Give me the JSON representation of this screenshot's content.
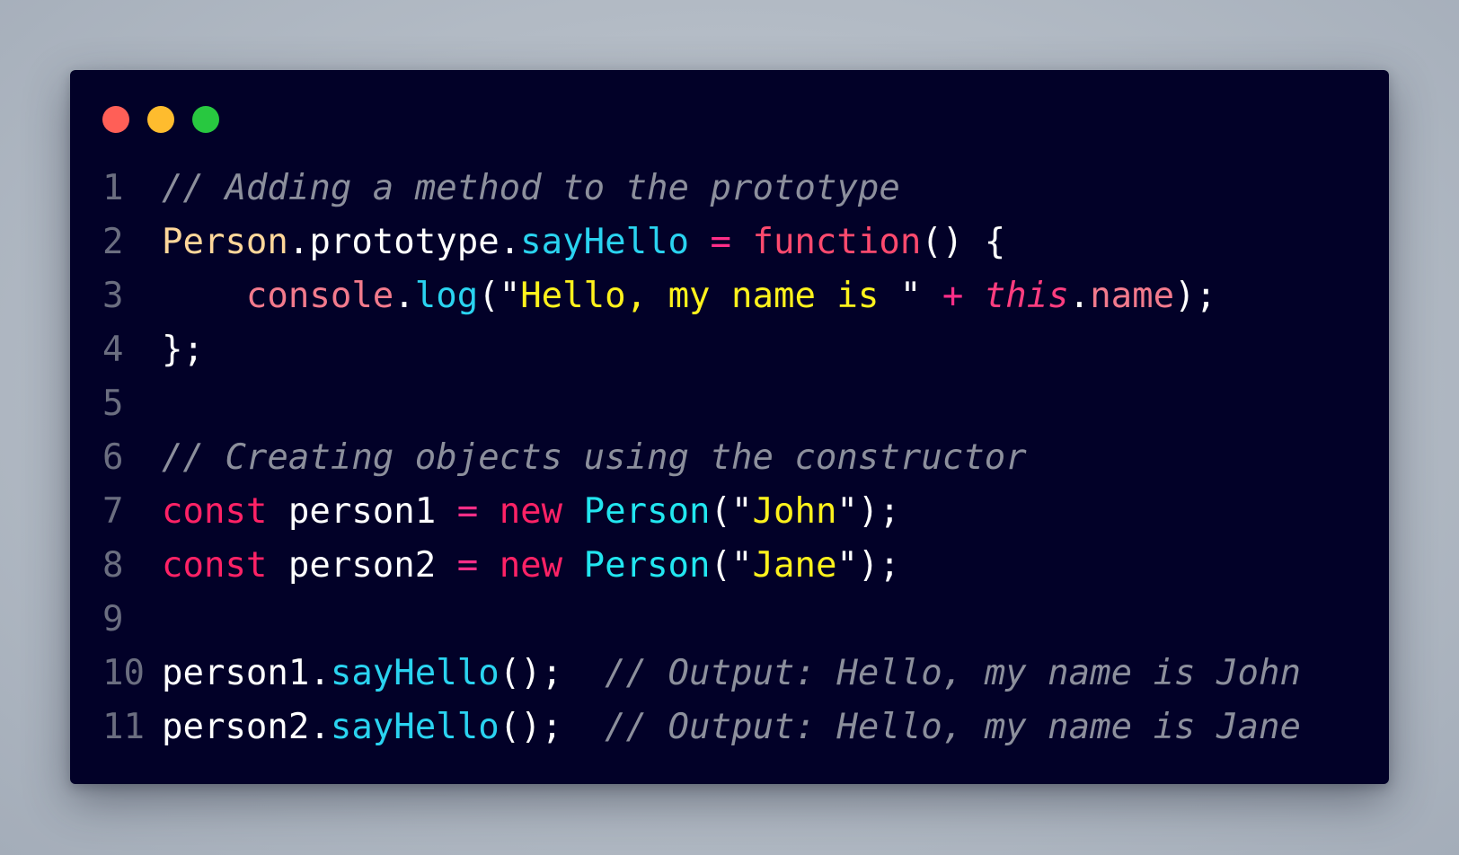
{
  "window": {
    "controls": {
      "close_color": "#ff5f57",
      "minimize_color": "#febc2e",
      "maximize_color": "#28c840"
    },
    "background_color": "#020128"
  },
  "code": {
    "lines": [
      {
        "number": "1",
        "tokens": [
          {
            "text": "// Adding a method to the prototype",
            "type": "comment"
          }
        ]
      },
      {
        "number": "2",
        "tokens": [
          {
            "text": "Person",
            "type": "cls"
          },
          {
            "text": ".prototype.",
            "type": "plain"
          },
          {
            "text": "sayHello",
            "type": "method"
          },
          {
            "text": " ",
            "type": "plain"
          },
          {
            "text": "=",
            "type": "op"
          },
          {
            "text": " ",
            "type": "plain"
          },
          {
            "text": "function",
            "type": "fn"
          },
          {
            "text": "() {",
            "type": "plain"
          }
        ]
      },
      {
        "number": "3",
        "tokens": [
          {
            "text": "    ",
            "type": "plain"
          },
          {
            "text": "console",
            "type": "obj"
          },
          {
            "text": ".",
            "type": "plain"
          },
          {
            "text": "log",
            "type": "method"
          },
          {
            "text": "(\"",
            "type": "plain"
          },
          {
            "text": "Hello, my name is ",
            "type": "str"
          },
          {
            "text": "\" ",
            "type": "plain"
          },
          {
            "text": "+",
            "type": "op"
          },
          {
            "text": " ",
            "type": "plain"
          },
          {
            "text": "this",
            "type": "thiskw"
          },
          {
            "text": ".",
            "type": "plain"
          },
          {
            "text": "name",
            "type": "prop"
          },
          {
            "text": ");",
            "type": "plain"
          }
        ]
      },
      {
        "number": "4",
        "tokens": [
          {
            "text": "};",
            "type": "plain"
          }
        ]
      },
      {
        "number": "5",
        "tokens": []
      },
      {
        "number": "6",
        "tokens": [
          {
            "text": "// Creating objects using the constructor",
            "type": "comment"
          }
        ]
      },
      {
        "number": "7",
        "tokens": [
          {
            "text": "const",
            "type": "kw"
          },
          {
            "text": " person1 ",
            "type": "plain"
          },
          {
            "text": "=",
            "type": "op"
          },
          {
            "text": " ",
            "type": "plain"
          },
          {
            "text": "new",
            "type": "kw"
          },
          {
            "text": " ",
            "type": "plain"
          },
          {
            "text": "Person",
            "type": "ctor"
          },
          {
            "text": "(\"",
            "type": "plain"
          },
          {
            "text": "John",
            "type": "str"
          },
          {
            "text": "\");",
            "type": "plain"
          }
        ]
      },
      {
        "number": "8",
        "tokens": [
          {
            "text": "const",
            "type": "kw"
          },
          {
            "text": " person2 ",
            "type": "plain"
          },
          {
            "text": "=",
            "type": "op"
          },
          {
            "text": " ",
            "type": "plain"
          },
          {
            "text": "new",
            "type": "kw"
          },
          {
            "text": " ",
            "type": "plain"
          },
          {
            "text": "Person",
            "type": "ctor"
          },
          {
            "text": "(\"",
            "type": "plain"
          },
          {
            "text": "Jane",
            "type": "str"
          },
          {
            "text": "\");",
            "type": "plain"
          }
        ]
      },
      {
        "number": "9",
        "tokens": []
      },
      {
        "number": "10",
        "tokens": [
          {
            "text": "person1.",
            "type": "plain"
          },
          {
            "text": "sayHello",
            "type": "method"
          },
          {
            "text": "();  ",
            "type": "plain"
          },
          {
            "text": "// Output: Hello, my name is John",
            "type": "comment"
          }
        ]
      },
      {
        "number": "11",
        "tokens": [
          {
            "text": "person2.",
            "type": "plain"
          },
          {
            "text": "sayHello",
            "type": "method"
          },
          {
            "text": "();  ",
            "type": "plain"
          },
          {
            "text": "// Output: Hello, my name is Jane",
            "type": "comment"
          }
        ]
      }
    ]
  }
}
